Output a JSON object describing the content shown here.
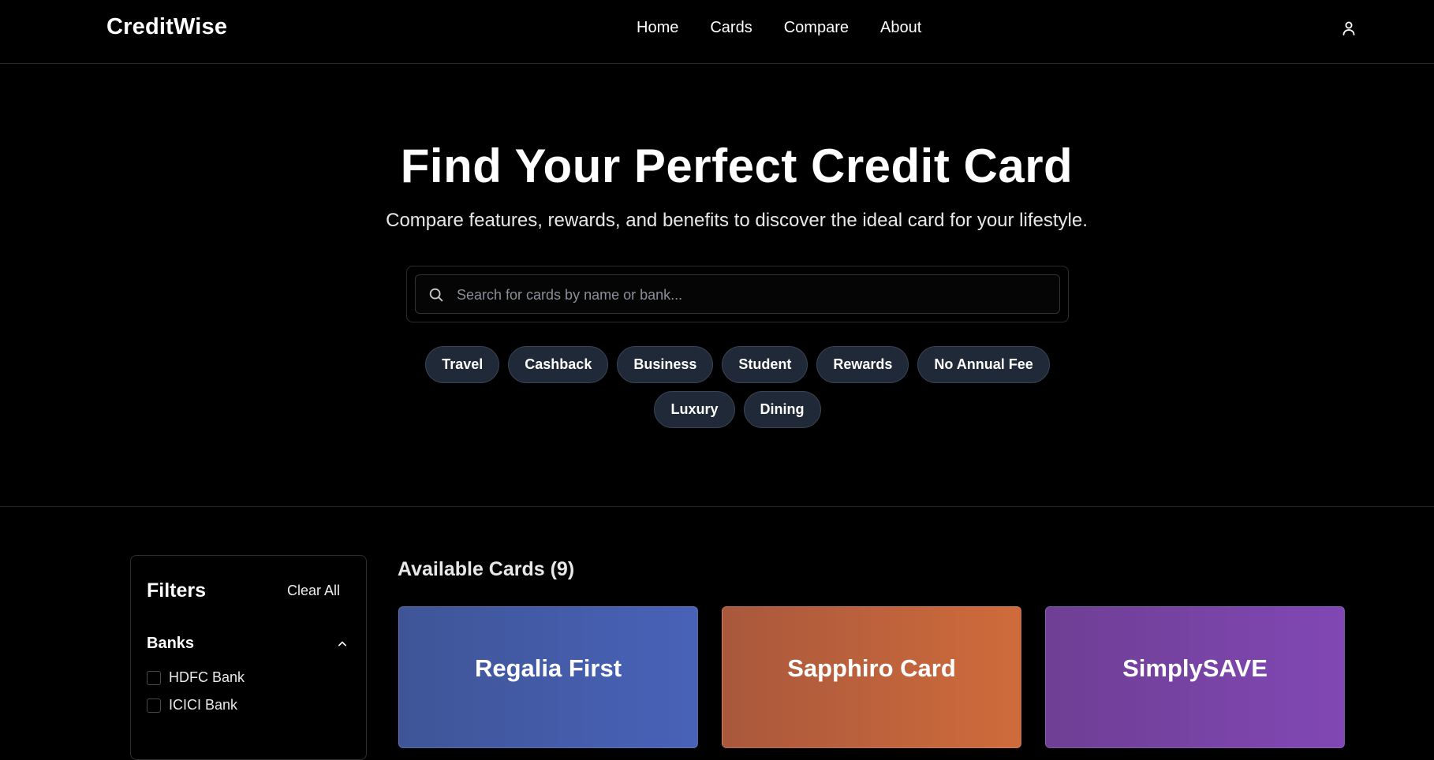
{
  "brand": "CreditWise",
  "nav": {
    "items": [
      {
        "label": "Home"
      },
      {
        "label": "Cards"
      },
      {
        "label": "Compare"
      },
      {
        "label": "About"
      }
    ],
    "user_icon": "user-icon"
  },
  "hero": {
    "title": "Find Your Perfect Credit Card",
    "subtitle": "Compare features, rewards, and benefits to discover the ideal card for your lifestyle."
  },
  "search": {
    "placeholder": "Search for cards by name or bank...",
    "value": "",
    "icon": "search-icon"
  },
  "categories": [
    {
      "label": "Travel"
    },
    {
      "label": "Cashback"
    },
    {
      "label": "Business"
    },
    {
      "label": "Student"
    },
    {
      "label": "Rewards"
    },
    {
      "label": "No Annual Fee"
    },
    {
      "label": "Luxury"
    },
    {
      "label": "Dining"
    }
  ],
  "filters": {
    "title": "Filters",
    "clear_label": "Clear All",
    "banks": {
      "title": "Banks",
      "icon": "chevron-up-icon",
      "options": [
        {
          "label": "HDFC Bank",
          "checked": false
        },
        {
          "label": "ICICI Bank",
          "checked": false
        }
      ]
    }
  },
  "cards_section": {
    "title": "Available Cards (9)",
    "cards": [
      {
        "name": "Regalia First",
        "color": "#4862b8"
      },
      {
        "name": "Sapphiro Card",
        "color": "#cf6b3b"
      },
      {
        "name": "SimplySAVE",
        "color": "#8147b4"
      }
    ]
  },
  "colors": {
    "background": "#000000",
    "chip_bg": "#1f2937",
    "chip_border": "#3a4454"
  }
}
